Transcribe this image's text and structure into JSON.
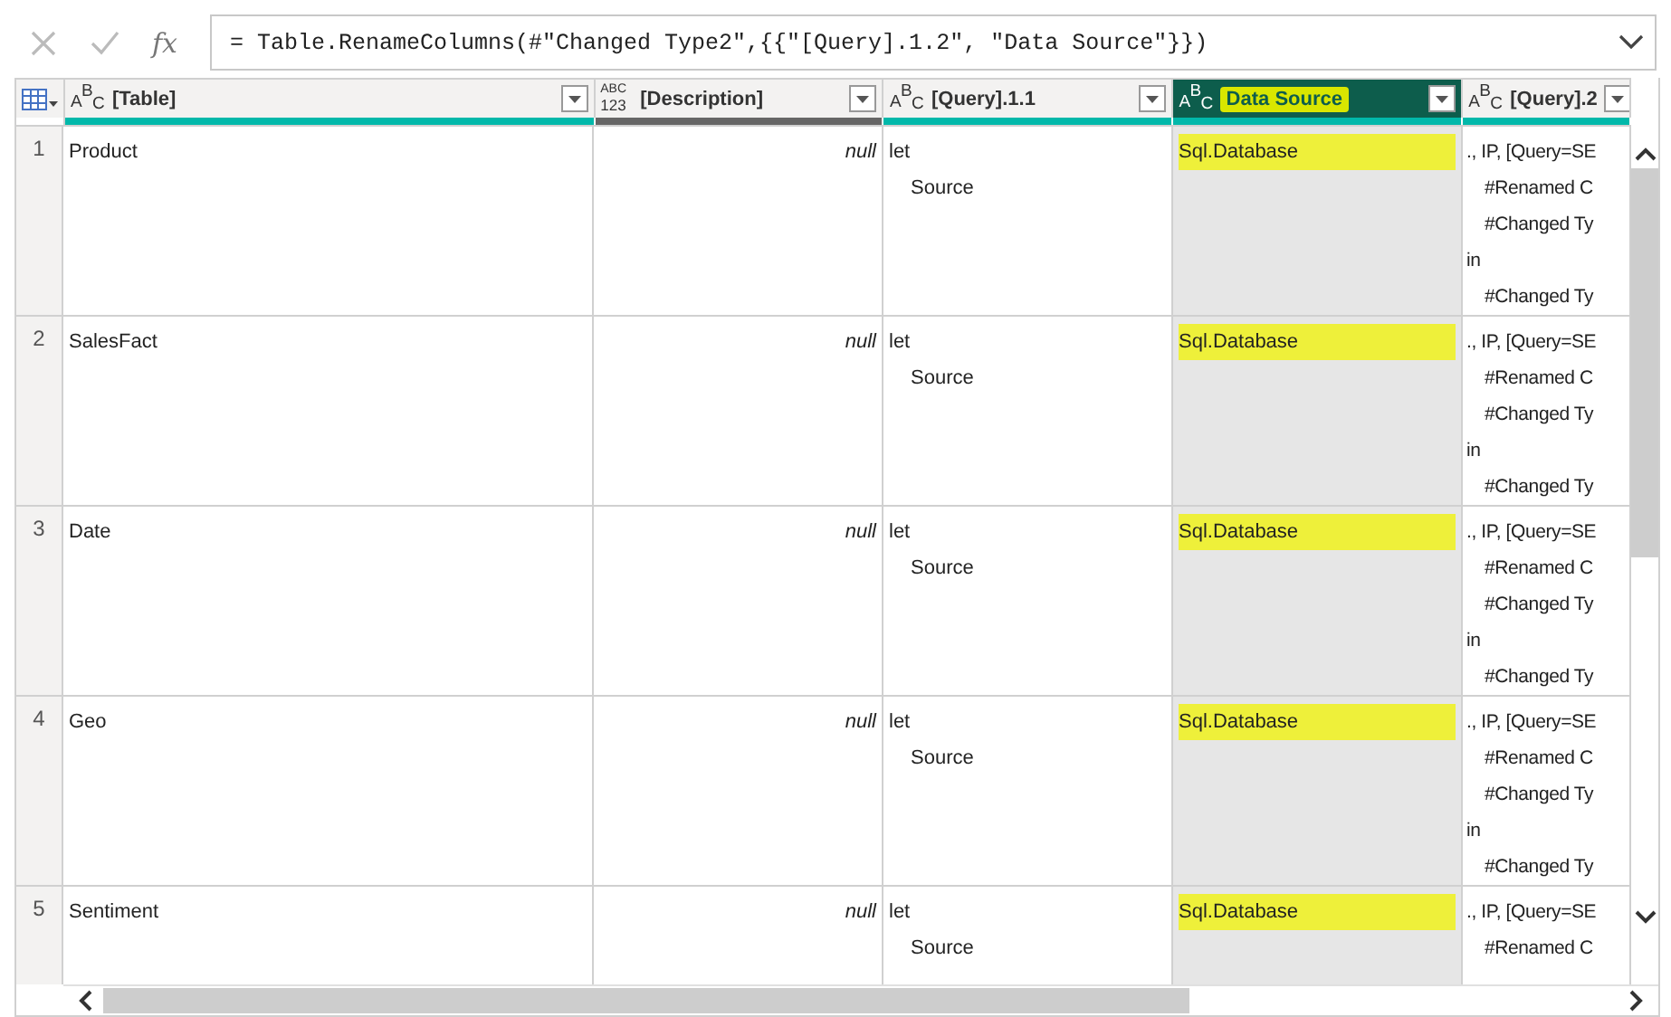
{
  "formula_bar": {
    "fx_label": "fx",
    "formula": "= Table.RenameColumns(#\"Changed Type2\",{{\"[Query].1.2\", \"Data Source\"}})"
  },
  "table": {
    "columns": [
      {
        "name": "[Table]",
        "kind": "text",
        "type_glyphs": [
          "A",
          "B",
          "C"
        ],
        "selected": false,
        "color": "#01b8aa"
      },
      {
        "name": "[Description]",
        "kind": "any",
        "type_glyphs": [
          "ABC",
          "123"
        ],
        "selected": false,
        "color": "#666666"
      },
      {
        "name": "[Query].1.1",
        "kind": "text",
        "type_glyphs": [
          "A",
          "B",
          "C"
        ],
        "selected": false,
        "color": "#01b8aa"
      },
      {
        "name": "Data Source",
        "kind": "text",
        "type_glyphs": [
          "A",
          "B",
          "C"
        ],
        "selected": true,
        "color": "#01b8aa"
      },
      {
        "name": "[Query].2",
        "kind": "text",
        "type_glyphs": [
          "A",
          "B",
          "C"
        ],
        "selected": false,
        "color": "#01b8aa"
      }
    ],
    "rows": [
      {
        "number": "1",
        "cells": [
          [
            "Product"
          ],
          [
            "null"
          ],
          [
            "let",
            "Source"
          ],
          [
            "Sql.Database"
          ],
          [
            "., IP, [Query=SE",
            "#Renamed C",
            "#Changed Ty",
            "in",
            "#Changed Ty"
          ]
        ]
      },
      {
        "number": "2",
        "cells": [
          [
            "SalesFact"
          ],
          [
            "null"
          ],
          [
            "let",
            "Source"
          ],
          [
            "Sql.Database"
          ],
          [
            "., IP, [Query=SE",
            "#Renamed C",
            "#Changed Ty",
            "in",
            "#Changed Ty"
          ]
        ]
      },
      {
        "number": "3",
        "cells": [
          [
            "Date"
          ],
          [
            "null"
          ],
          [
            "let",
            "Source"
          ],
          [
            "Sql.Database"
          ],
          [
            "., IP, [Query=SE",
            "#Renamed C",
            "#Changed Ty",
            "in",
            "#Changed Ty"
          ]
        ]
      },
      {
        "number": "4",
        "cells": [
          [
            "Geo"
          ],
          [
            "null"
          ],
          [
            "let",
            "Source"
          ],
          [
            "Sql.Database"
          ],
          [
            "., IP, [Query=SE",
            "#Renamed C",
            "#Changed Ty",
            "in",
            "#Changed Ty"
          ]
        ]
      },
      {
        "number": "5",
        "cells": [
          [
            "Sentiment"
          ],
          [
            "null"
          ],
          [
            "let",
            "Source"
          ],
          [
            "Sql.Database"
          ],
          [
            "., IP, [Query=SE",
            "#Renamed C"
          ]
        ]
      }
    ]
  }
}
